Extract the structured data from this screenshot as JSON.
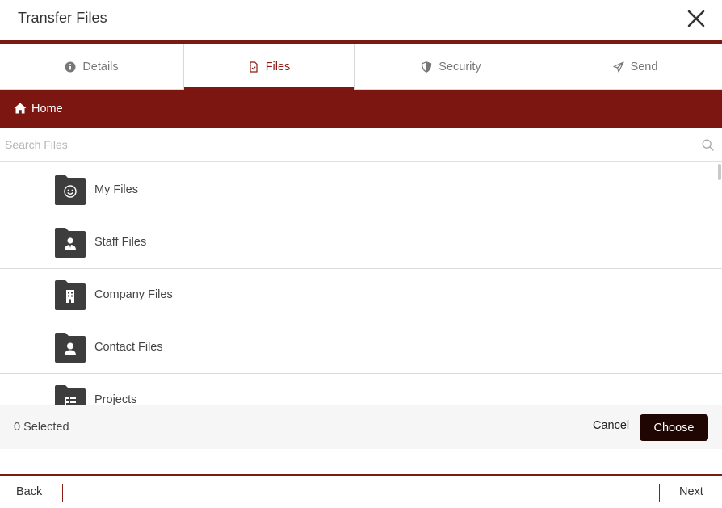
{
  "dialog": {
    "title": "Transfer Files"
  },
  "tabs": [
    {
      "label": "Details",
      "icon": "info-icon",
      "active": false
    },
    {
      "label": "Files",
      "icon": "file-check-icon",
      "active": true
    },
    {
      "label": "Security",
      "icon": "shield-icon",
      "active": false
    },
    {
      "label": "Send",
      "icon": "paper-plane-icon",
      "active": false
    }
  ],
  "breadcrumb": {
    "label": "Home",
    "icon": "home-icon"
  },
  "search": {
    "placeholder": "Search Files",
    "value": ""
  },
  "folders": [
    {
      "name": "My Files",
      "icon": "folder-smiley-icon"
    },
    {
      "name": "Staff Files",
      "icon": "folder-staff-icon"
    },
    {
      "name": "Company Files",
      "icon": "folder-building-icon"
    },
    {
      "name": "Contact Files",
      "icon": "folder-contact-icon"
    },
    {
      "name": "Projects",
      "icon": "folder-projects-icon"
    }
  ],
  "selection": {
    "count_label": "0 Selected",
    "cancel_label": "Cancel",
    "choose_label": "Choose"
  },
  "footer": {
    "back_label": "Back",
    "next_label": "Next"
  },
  "colors": {
    "accent": "#7b1a12",
    "breadcrumb_bg": "#7b1610",
    "choose_bg": "#1f0603",
    "folder": "#3d3d3d"
  }
}
